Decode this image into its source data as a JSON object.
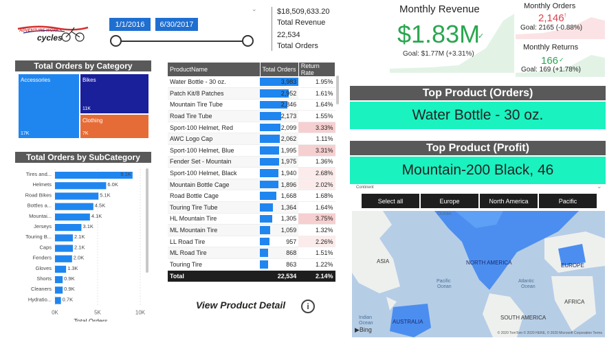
{
  "logo": {
    "brand_top": "ADVENTURE WORKS",
    "brand_bottom": "cycles"
  },
  "date_filter": {
    "start": "1/1/2016",
    "end": "6/30/2017"
  },
  "kpis": {
    "total_revenue_value": "$18,509,633.20",
    "total_revenue_label": "Total Revenue",
    "total_orders_value": "22,534",
    "total_orders_label": "Total Orders"
  },
  "monthly_revenue": {
    "title": "Monthly Revenue",
    "value": "$1.83M",
    "goal": "Goal: $1.77M (+3.31%)",
    "trend": "up"
  },
  "monthly_orders": {
    "title": "Monthly Orders",
    "value": "2,146",
    "goal": "Goal: 2165 (-0.88%)",
    "trend": "down"
  },
  "monthly_returns": {
    "title": "Monthly Returns",
    "value": "166",
    "goal": "Goal: 169 (+1.78%)",
    "trend": "up"
  },
  "treemap": {
    "title": "Total Orders by Category",
    "tiles": [
      {
        "name": "Accessories",
        "value": "17K",
        "color": "#1f86f0"
      },
      {
        "name": "Bikes",
        "value": "11K",
        "color": "#1a1f9a"
      },
      {
        "name": "Clothing",
        "value": "7K",
        "color": "#e66c37"
      }
    ]
  },
  "chart_data": {
    "type": "bar",
    "title": "Total Orders by SubCategory",
    "orientation": "horizontal",
    "categories": [
      "Tires and...",
      "Helmets",
      "Road Bikes",
      "Bottles a...",
      "Mountai...",
      "Jerseys",
      "Touring B...",
      "Caps",
      "Fenders",
      "Gloves",
      "Shorts",
      "Cleaners",
      "Hydratio..."
    ],
    "values": [
      9100,
      6000,
      5100,
      4500,
      4100,
      3100,
      2100,
      2100,
      2000,
      1300,
      900,
      900,
      700
    ],
    "data_labels": [
      "9.1K",
      "6.0K",
      "5.1K",
      "4.5K",
      "4.1K",
      "3.1K",
      "2.1K",
      "2.1K",
      "2.0K",
      "1.3K",
      "0.9K",
      "0.9K",
      "0.7K"
    ],
    "xlabel": "Total Orders",
    "ylabel": "",
    "xlim": [
      0,
      10000
    ],
    "ticks": [
      "0K",
      "5K",
      "10K"
    ],
    "color": "#1f86f0",
    "grid": true
  },
  "product_table": {
    "columns": [
      "ProductName",
      "Total Orders",
      "Return Rate"
    ],
    "rows": [
      {
        "name": "Water Bottle - 30 oz.",
        "orders": "3,983",
        "orders_frac": 1.0,
        "rate": "1.95%",
        "rate_level": 0
      },
      {
        "name": "Patch Kit/8 Patches",
        "orders": "2,952",
        "orders_frac": 0.741,
        "rate": "1.61%",
        "rate_level": 0
      },
      {
        "name": "Mountain Tire Tube",
        "orders": "2,846",
        "orders_frac": 0.715,
        "rate": "1.64%",
        "rate_level": 0
      },
      {
        "name": "Road Tire Tube",
        "orders": "2,173",
        "orders_frac": 0.546,
        "rate": "1.55%",
        "rate_level": 0
      },
      {
        "name": "Sport-100 Helmet, Red",
        "orders": "2,099",
        "orders_frac": 0.527,
        "rate": "3.33%",
        "rate_level": 2
      },
      {
        "name": "AWC Logo Cap",
        "orders": "2,062",
        "orders_frac": 0.518,
        "rate": "1.11%",
        "rate_level": 0
      },
      {
        "name": "Sport-100 Helmet, Blue",
        "orders": "1,995",
        "orders_frac": 0.501,
        "rate": "3.31%",
        "rate_level": 2
      },
      {
        "name": "Fender Set - Mountain",
        "orders": "1,975",
        "orders_frac": 0.496,
        "rate": "1.36%",
        "rate_level": 0
      },
      {
        "name": "Sport-100 Helmet, Black",
        "orders": "1,940",
        "orders_frac": 0.487,
        "rate": "2.68%",
        "rate_level": 1
      },
      {
        "name": "Mountain Bottle Cage",
        "orders": "1,896",
        "orders_frac": 0.476,
        "rate": "2.02%",
        "rate_level": 1
      },
      {
        "name": "Road Bottle Cage",
        "orders": "1,668",
        "orders_frac": 0.419,
        "rate": "1.68%",
        "rate_level": 0
      },
      {
        "name": "Touring Tire Tube",
        "orders": "1,364",
        "orders_frac": 0.342,
        "rate": "1.64%",
        "rate_level": 0
      },
      {
        "name": "HL Mountain Tire",
        "orders": "1,305",
        "orders_frac": 0.328,
        "rate": "3.75%",
        "rate_level": 2
      },
      {
        "name": "ML Mountain Tire",
        "orders": "1,059",
        "orders_frac": 0.266,
        "rate": "1.32%",
        "rate_level": 0
      },
      {
        "name": "LL Road Tire",
        "orders": "957",
        "orders_frac": 0.24,
        "rate": "2.26%",
        "rate_level": 1
      },
      {
        "name": "ML Road Tire",
        "orders": "868",
        "orders_frac": 0.218,
        "rate": "1.51%",
        "rate_level": 0
      },
      {
        "name": "Touring Tire",
        "orders": "863",
        "orders_frac": 0.217,
        "rate": "1.22%",
        "rate_level": 0
      }
    ],
    "total": {
      "label": "Total",
      "orders": "22,534",
      "rate": "2.14%"
    }
  },
  "view_detail": {
    "label": "View Product Detail",
    "icon": "info-icon"
  },
  "top_product_orders": {
    "title": "Top Product (Orders)",
    "value": "Water Bottle - 30 oz."
  },
  "top_product_profit": {
    "title": "Top Product (Profit)",
    "value": "Mountain-200 Black, 46"
  },
  "continent_slicer": {
    "label": "Continent",
    "options": [
      "Select all",
      "Europe",
      "North America",
      "Pacific"
    ]
  },
  "map": {
    "labels": [
      "Ocean",
      "ASIA",
      "NORTH AMERICA",
      "EUROPE",
      "Pacific",
      "Ocean",
      "Atlantic",
      "Ocean",
      "AFRICA",
      "Indian",
      "Ocean",
      "AUSTRALIA",
      "SOUTH AMERICA"
    ],
    "attribution": "© 2020 TomTom © 2020 HERE, © 2020 Microsoft Corporation  Terms",
    "provider": "Bing"
  },
  "colors": {
    "primary_blue": "#1f86f0",
    "dark_blue": "#1a1f9a",
    "orange": "#e66c37",
    "teal": "#1af2c0",
    "green": "#2aa64f",
    "red": "#d9434d",
    "header_gray": "#595959"
  }
}
